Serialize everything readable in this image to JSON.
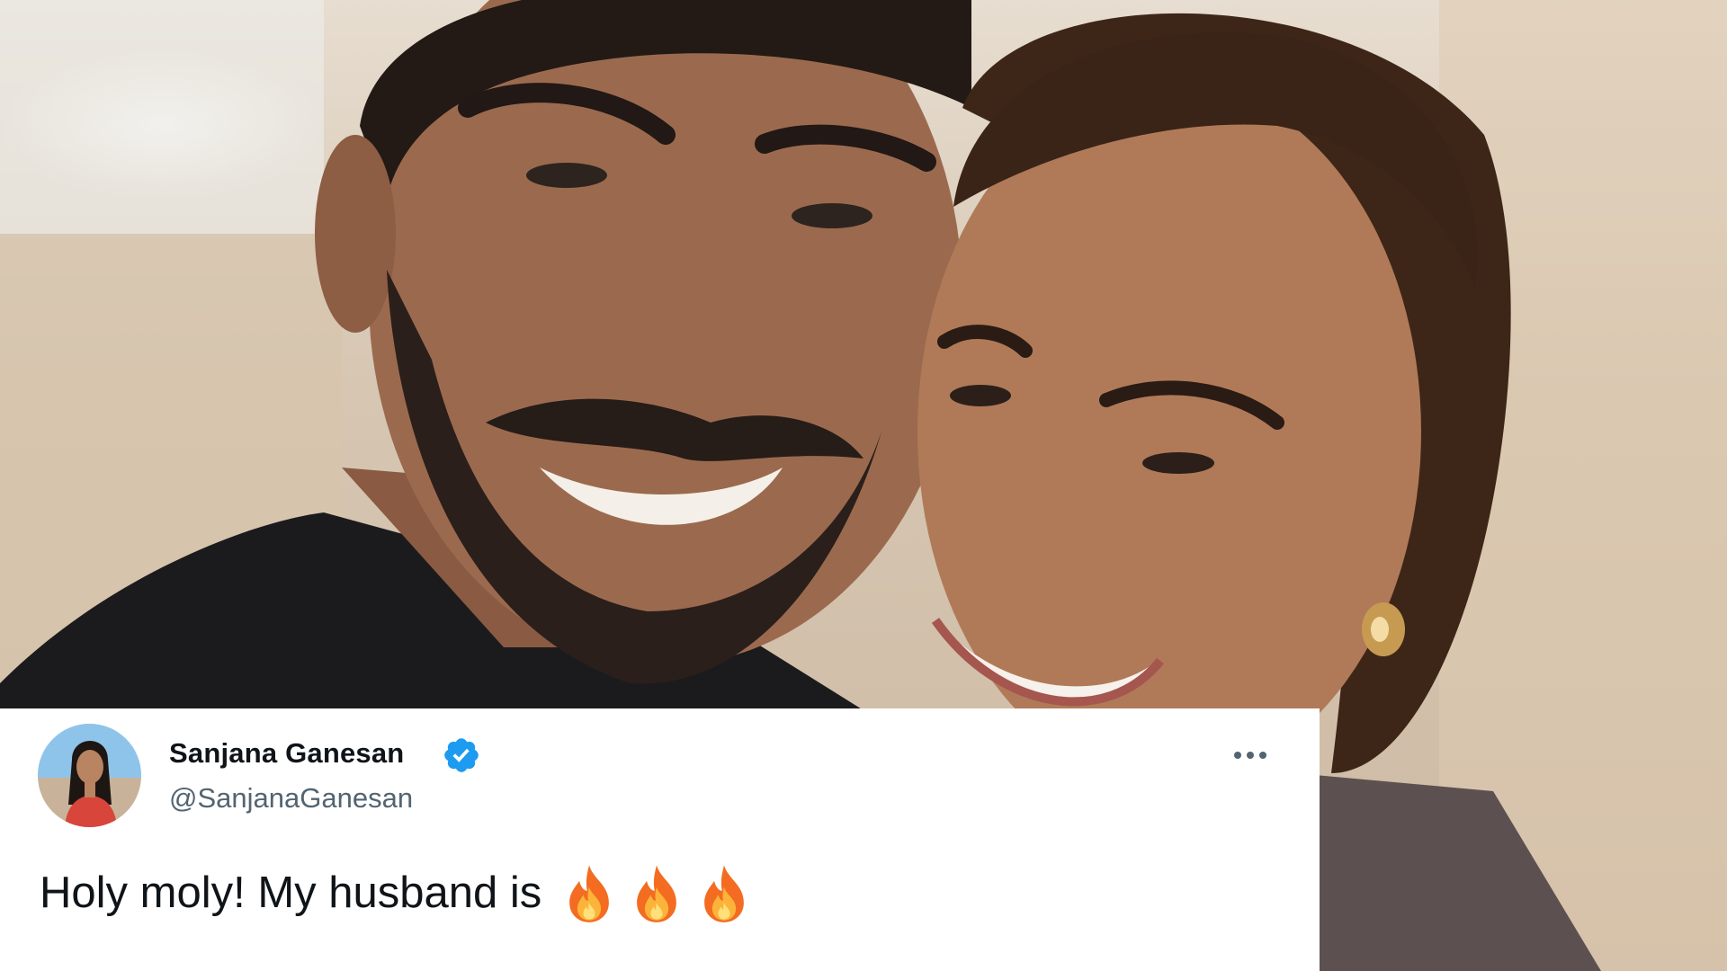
{
  "tweet": {
    "display_name": "Sanjana Ganesan",
    "handle": "@SanjanaGanesan",
    "text": "Holy moly! My husband is",
    "emojis": [
      "fire",
      "fire",
      "fire"
    ],
    "verified": true
  },
  "icons": {
    "verified": "verified-badge-icon",
    "more": "more-options-icon",
    "fire": "fire-icon"
  },
  "colors": {
    "verified_blue": "#1d9bf0",
    "name_text": "#0f1419",
    "handle_text": "#536471",
    "card_background": "#ffffff"
  }
}
